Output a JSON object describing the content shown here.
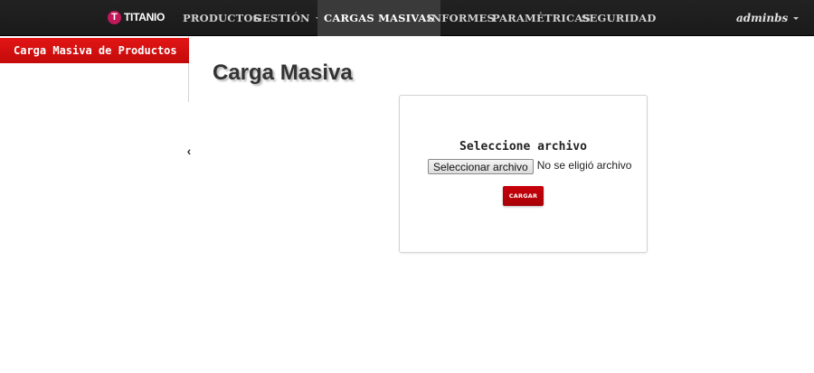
{
  "brand": {
    "logo_letter": "T",
    "name": "TITANIO"
  },
  "nav": {
    "items": [
      {
        "label": "PRODUCTOS"
      },
      {
        "label": "GESTIÓN"
      },
      {
        "label": "CARGAS MASIVAS"
      },
      {
        "label": "INFORMES"
      },
      {
        "label": "PARAMÉTRICAS"
      },
      {
        "label": "SEGURIDAD"
      }
    ],
    "active": "CARGAS MASIVAS",
    "user": "adminbs"
  },
  "sidebar": {
    "items": [
      {
        "label": "Carga Masiva de Productos"
      }
    ],
    "collapse_icon": "chevron-left-icon"
  },
  "main": {
    "title": "Carga Masiva",
    "upload": {
      "heading": "Seleccione archivo",
      "file_button": "Seleccionar archivo",
      "file_status": "No se eligió archivo",
      "submit_label": "CARGAR"
    }
  },
  "colors": {
    "navbar": "#222222",
    "accent_red": "#c40a0a",
    "brand_logo": "#c2185b"
  }
}
